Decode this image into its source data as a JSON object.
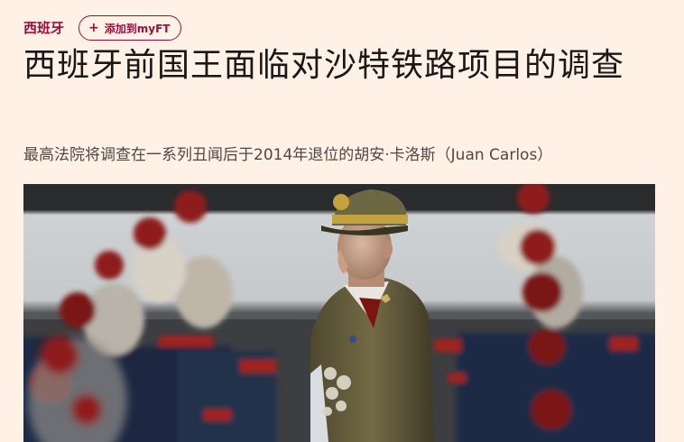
{
  "header": {
    "section_label": "西班牙",
    "myft_button_label": "添加到myFT",
    "plus_icon": "+"
  },
  "article": {
    "headline": "西班牙前国王面临对沙特铁路项目的调查",
    "standfirst": "最高法院将调查在一系列丑闻后于2014年退位的胡安·卡洛斯（Juan Carlos）"
  },
  "photo": {
    "subject": "former-king-in-uniform-with-honor-guard",
    "colors": {
      "uniform_olive": "#6b6240",
      "guard_blue": "#1d2a44",
      "plume_red": "#8e1c1c",
      "background_grey": "#cfd2d4"
    }
  }
}
